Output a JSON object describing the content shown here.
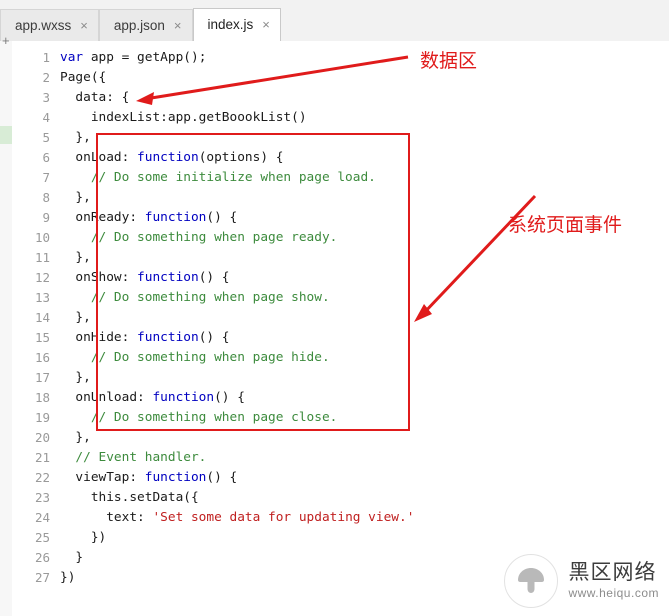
{
  "tabs": [
    {
      "label": "app.wxss",
      "close": "×",
      "active": false
    },
    {
      "label": "app.json",
      "close": "×",
      "active": false
    },
    {
      "label": "index.js",
      "close": "×",
      "active": true
    }
  ],
  "gutter": {
    "new_file_icon": "+",
    "line_numbers": [
      "1",
      "2",
      "3",
      "4",
      "5",
      "6",
      "7",
      "8",
      "9",
      "10",
      "11",
      "12",
      "13",
      "14",
      "15",
      "16",
      "17",
      "18",
      "19",
      "20",
      "21",
      "22",
      "23",
      "24",
      "25",
      "26",
      "27"
    ]
  },
  "code_lines": [
    [
      {
        "t": "var ",
        "c": "kw"
      },
      {
        "t": "app = getApp();",
        "c": ""
      }
    ],
    [
      {
        "t": "Page({",
        "c": ""
      }
    ],
    [
      {
        "t": "  data: {",
        "c": ""
      }
    ],
    [
      {
        "t": "    indexList:app.getBoookList()",
        "c": ""
      }
    ],
    [
      {
        "t": "  },",
        "c": ""
      }
    ],
    [
      {
        "t": "  onLoad: ",
        "c": ""
      },
      {
        "t": "function",
        "c": "kw"
      },
      {
        "t": "(options) {",
        "c": ""
      }
    ],
    [
      {
        "t": "    // Do some initialize when page load.",
        "c": "cm"
      }
    ],
    [
      {
        "t": "  },",
        "c": ""
      }
    ],
    [
      {
        "t": "  onReady: ",
        "c": ""
      },
      {
        "t": "function",
        "c": "kw"
      },
      {
        "t": "() {",
        "c": ""
      }
    ],
    [
      {
        "t": "    // Do something when page ready.",
        "c": "cm"
      }
    ],
    [
      {
        "t": "  },",
        "c": ""
      }
    ],
    [
      {
        "t": "  onShow: ",
        "c": ""
      },
      {
        "t": "function",
        "c": "kw"
      },
      {
        "t": "() {",
        "c": ""
      }
    ],
    [
      {
        "t": "    // Do something when page show.",
        "c": "cm"
      }
    ],
    [
      {
        "t": "  },",
        "c": ""
      }
    ],
    [
      {
        "t": "  onHide: ",
        "c": ""
      },
      {
        "t": "function",
        "c": "kw"
      },
      {
        "t": "() {",
        "c": ""
      }
    ],
    [
      {
        "t": "    // Do something when page hide.",
        "c": "cm"
      }
    ],
    [
      {
        "t": "  },",
        "c": ""
      }
    ],
    [
      {
        "t": "  onUnload: ",
        "c": ""
      },
      {
        "t": "function",
        "c": "kw"
      },
      {
        "t": "() {",
        "c": ""
      }
    ],
    [
      {
        "t": "    // Do something when page close.",
        "c": "cm"
      }
    ],
    [
      {
        "t": "  },",
        "c": ""
      }
    ],
    [
      {
        "t": "  // Event handler.",
        "c": "cm"
      }
    ],
    [
      {
        "t": "  viewTap: ",
        "c": ""
      },
      {
        "t": "function",
        "c": "kw"
      },
      {
        "t": "() {",
        "c": ""
      }
    ],
    [
      {
        "t": "    this.setData({",
        "c": ""
      }
    ],
    [
      {
        "t": "      text: ",
        "c": ""
      },
      {
        "t": "'Set some data for updating view.'",
        "c": "str"
      }
    ],
    [
      {
        "t": "    })",
        "c": ""
      }
    ],
    [
      {
        "t": "  }",
        "c": ""
      }
    ],
    [
      {
        "t": "})",
        "c": ""
      }
    ]
  ],
  "annotations": {
    "data_region_label": "数据区",
    "page_events_label": "系统页面事件",
    "accent_color": "#e01b1b"
  },
  "watermark": {
    "main": "黑区网络",
    "sub": "www.heiqu.com"
  }
}
